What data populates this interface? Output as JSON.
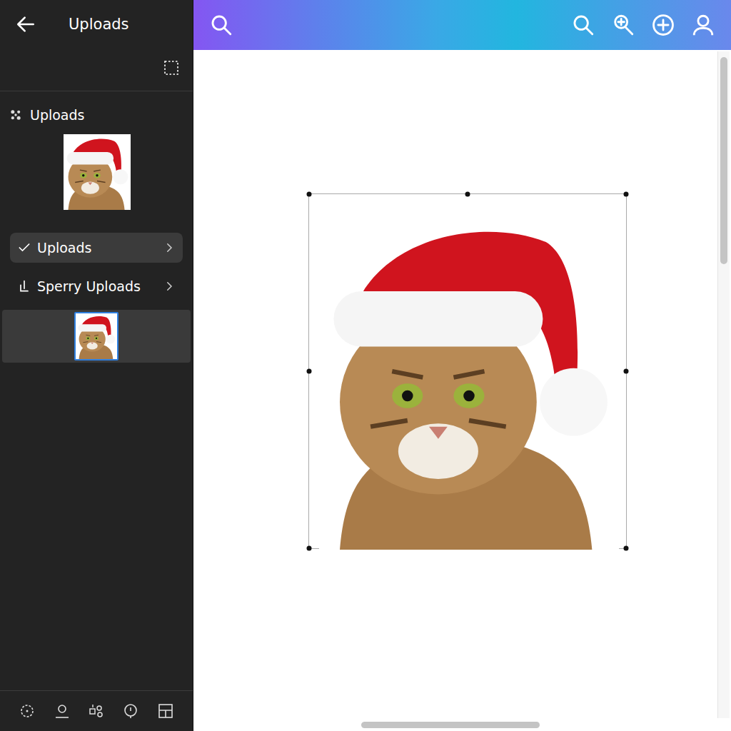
{
  "sidebar": {
    "title": "Uploads",
    "section": {
      "label": "Uploads"
    },
    "folders": [
      {
        "label": "Uploads",
        "checked": true,
        "selected": true
      },
      {
        "label": "Sperry Uploads",
        "checked": false,
        "selected": false
      }
    ],
    "files": [
      {
        "selected": true
      }
    ]
  },
  "canvas": {
    "image_selected": true
  }
}
